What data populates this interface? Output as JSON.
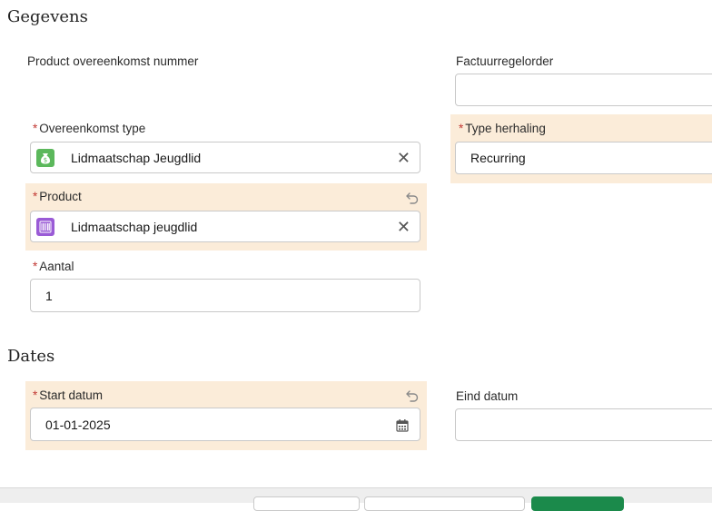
{
  "sections": {
    "gegevens_title": "Gegevens",
    "dates_title": "Dates"
  },
  "fields": {
    "product_nummer": {
      "label": "Product overeenkomst nummer"
    },
    "factuurregelorder": {
      "label": "Factuurregelorder",
      "value": ""
    },
    "overeenkomst_type": {
      "required": "*",
      "label": "Overeenkomst type",
      "value": "Lidmaatschap Jeugdlid",
      "icon": "money-bag-icon",
      "icon_color": "#5cb85c"
    },
    "type_herhaling": {
      "required": "*",
      "label": "Type herhaling",
      "value": "Recurring"
    },
    "product": {
      "required": "*",
      "label": "Product",
      "value": "Lidmaatschap jeugdlid",
      "icon": "barcode-icon",
      "icon_color": "#9a5bd6"
    },
    "aantal": {
      "required": "*",
      "label": "Aantal",
      "value": "1"
    },
    "start_datum": {
      "required": "*",
      "label": "Start datum",
      "value": "01-01-2025"
    },
    "eind_datum": {
      "label": "Eind datum",
      "value": ""
    }
  },
  "icons": {
    "clear": "✕",
    "calendar": "calendar-icon",
    "undo": "undo-icon"
  },
  "colors": {
    "required": "#c23934",
    "highlight": "#fbecd9",
    "primary_button": "#1b8a4b"
  }
}
